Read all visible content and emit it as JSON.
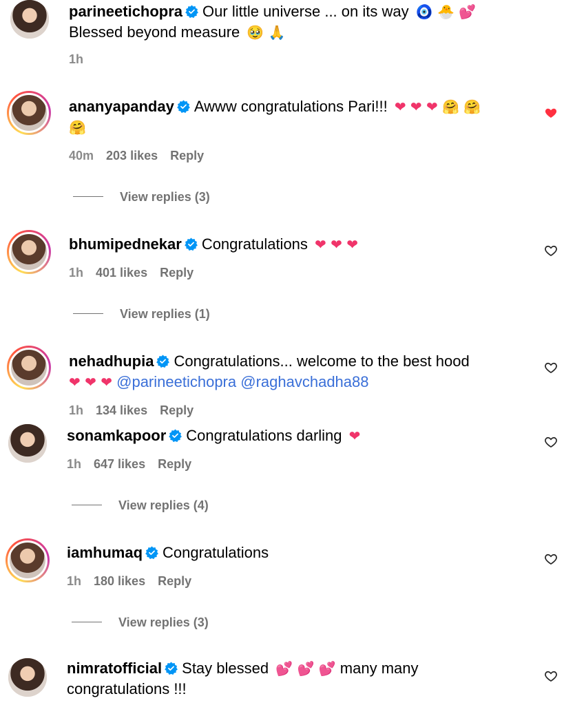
{
  "comments": [
    {
      "username": "parineetichopra",
      "text": "Our little universe ... on its way",
      "emoji": "🧿 🐣 💕",
      "text2": "Blessed beyond measure",
      "emoji2": "🥹 🙏",
      "time": "1h"
    },
    {
      "username": "ananyapanday",
      "text": "Awww congratulations Pari!!!",
      "emoji": "❤ ❤ ❤ 🤗 🤗",
      "emoji2": "🤗",
      "time": "40m",
      "likes": "203 likes",
      "reply": "Reply",
      "view_replies": "View replies (3)",
      "liked": true
    },
    {
      "username": "bhumipednekar",
      "text": "Congratulations",
      "emoji": "❤ ❤ ❤",
      "time": "1h",
      "likes": "401 likes",
      "reply": "Reply",
      "view_replies": "View replies (1)"
    },
    {
      "username": "nehadhupia",
      "text": "Congratulations... welcome to the best hood",
      "emoji": "❤ ❤ ❤",
      "mention1": "@parineetichopra",
      "mention2": "@raghavchadha88",
      "time": "1h",
      "likes": "134 likes",
      "reply": "Reply"
    },
    {
      "username": "sonamkapoor",
      "text": "Congratulations darling",
      "emoji": "❤",
      "time": "1h",
      "likes": "647 likes",
      "reply": "Reply",
      "view_replies": "View replies (4)"
    },
    {
      "username": "iamhumaq",
      "text": "Congratulations",
      "time": "1h",
      "likes": "180 likes",
      "reply": "Reply",
      "view_replies": "View replies (3)"
    },
    {
      "username": "nimratofficial",
      "text": "Stay blessed",
      "emoji": "💕 💕 💕",
      "text_after": "many many",
      "text2": "congratulations !!!"
    }
  ],
  "colors": {
    "verified": "#0095f6",
    "heart": "#ff3040",
    "mention": "#3a6fd8",
    "meta": "#737373"
  }
}
